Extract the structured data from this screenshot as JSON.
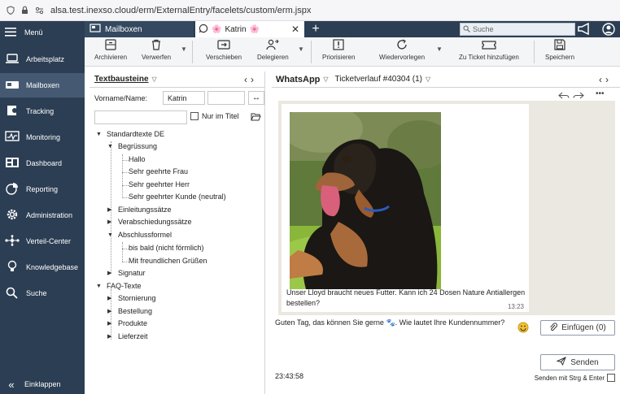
{
  "browser": {
    "url": "alsa.test.inexso.cloud/erm/ExternalEntry/facelets/custom/erm.jspx"
  },
  "sidebar": {
    "menu_label": "Menü",
    "items": [
      {
        "label": "Arbeitsplatz",
        "icon": "laptop-icon"
      },
      {
        "label": "Mailboxen",
        "icon": "mailbox-icon"
      },
      {
        "label": "Tracking",
        "icon": "tracking-icon"
      },
      {
        "label": "Monitoring",
        "icon": "monitor-icon"
      },
      {
        "label": "Dashboard",
        "icon": "dashboard-icon"
      },
      {
        "label": "Reporting",
        "icon": "pie-chart-icon"
      },
      {
        "label": "Administration",
        "icon": "gear-icon"
      },
      {
        "label": "Verteil-Center",
        "icon": "network-icon"
      },
      {
        "label": "Knowledgebase",
        "icon": "bulb-icon"
      },
      {
        "label": "Suche",
        "icon": "search-icon"
      }
    ],
    "collapse_label": "Einklappen",
    "active": "Mailboxen"
  },
  "tabs": {
    "mailbox_label": "Mailboxen",
    "katrin_label": "Katrin",
    "katrin_emoji": "🌸"
  },
  "search": {
    "placeholder": "Suche"
  },
  "toolbar": {
    "archive": "Archivieren",
    "reject": "Verwerfen",
    "move": "Verschieben",
    "delegate": "Delegieren",
    "prioritize": "Priorisieren",
    "resubmit": "Wiedervorlegen",
    "ticket": "Zu Ticket hinzufügen",
    "save": "Speichern"
  },
  "textbausteine": {
    "title": "Textbausteine",
    "firstname_label": "Vorname/Name:",
    "firstname_value": "Katrin",
    "only_title_label": "Nur im Titel",
    "tree": {
      "root": "Standardtexte DE",
      "greeting": "Begrüssung",
      "g1": "Hallo",
      "g2": "Sehr geehrte Frau",
      "g3": "Sehr geehrter Herr",
      "g4": "Sehr geehrter Kunde (neutral)",
      "intro": "Einleitungssätze",
      "farewell": "Verabschiedungssätze",
      "closing": "Abschlussformel",
      "c1": "bis bald (nicht förmlich)",
      "c2": "Mit freundlichen Grüßen",
      "signature": "Signatur",
      "faq": "FAQ-Texte",
      "f1": "Stornierung",
      "f2": "Bestellung",
      "f3": "Produkte",
      "f4": "Lieferzeit"
    }
  },
  "chat": {
    "channel": "WhatsApp",
    "ticket": "Ticketverlauf #40304 (1)",
    "message": "Unser Lloyd braucht neues Futter. Kann ich 24 Dosen Nature Antiallergen bestellen?",
    "message_time": "13:23",
    "draft_before": "Guten Tag, das können Sie gerne",
    "draft_emoji": "🐾",
    "draft_after": ". Wie lautet Ihre Kundennummer?",
    "insert_label": "Einfügen (0)",
    "send_label": "Senden",
    "clock": "23:43:58",
    "send_option": "Senden mit Strg & Enter"
  }
}
